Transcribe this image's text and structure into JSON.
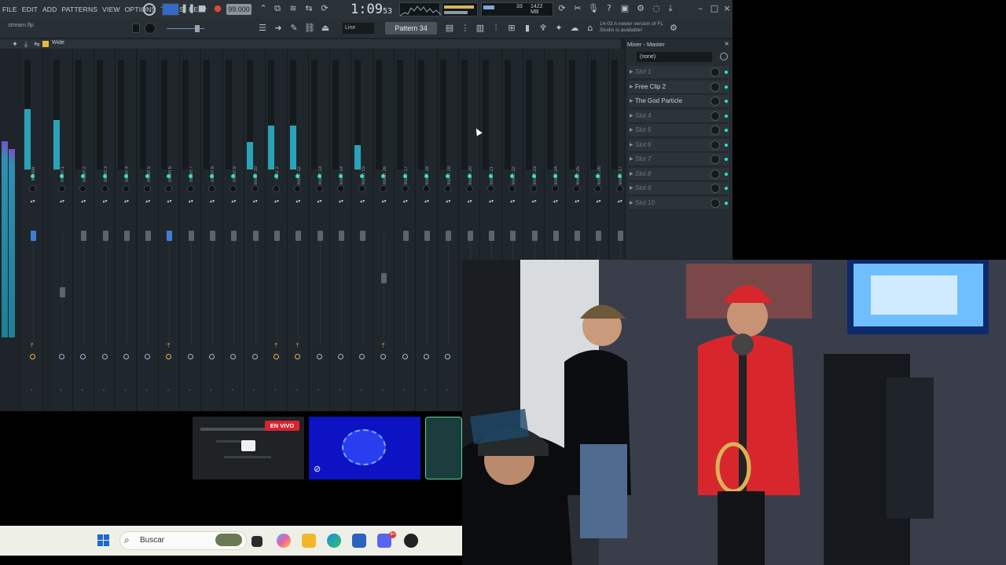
{
  "menu": [
    "FILE",
    "EDIT",
    "ADD",
    "PATTERNS",
    "VIEW",
    "OPTIONS",
    "TOOLS",
    "HELP"
  ],
  "transport": {
    "tempo": "99.000",
    "time_main": "1:09",
    "time_sub": "53",
    "memory": "1422 MB",
    "cpu": "33"
  },
  "project": {
    "name": "stream.flp"
  },
  "toolbar": {
    "snap": "Line",
    "pattern": "Pattern 34",
    "news": "14-03  A newer version of FL Studio is available!"
  },
  "mixer": {
    "view_label": "Wide",
    "panel_title": "Mixer - Master",
    "preset": "(none)",
    "slots": [
      {
        "name": "Slot 1",
        "active": false
      },
      {
        "name": "Free Clip 2",
        "active": true
      },
      {
        "name": "The God Particle",
        "active": true
      },
      {
        "name": "Slot 4",
        "active": false
      },
      {
        "name": "Slot 5",
        "active": false
      },
      {
        "name": "Slot 6",
        "active": false
      },
      {
        "name": "Slot 7",
        "active": false
      },
      {
        "name": "Slot 8",
        "active": false
      },
      {
        "name": "Slot 9",
        "active": false
      },
      {
        "name": "Slot 10",
        "active": false
      }
    ],
    "strips": [
      {
        "label": "Master",
        "level": 0.55
      },
      {
        "label": "Insert 1",
        "level": 0.45
      },
      {
        "label": "Insert 2",
        "level": 0
      },
      {
        "label": "Insert 3",
        "level": 0
      },
      {
        "label": "Insert 4",
        "level": 0
      },
      {
        "label": "Insert 5",
        "level": 0
      },
      {
        "label": "Insert 6",
        "level": 0
      },
      {
        "label": "Insert 7",
        "level": 0
      },
      {
        "label": "Insert 8",
        "level": 0
      },
      {
        "label": "Insert 9",
        "level": 0
      },
      {
        "label": "Insert 10",
        "level": 0.25
      },
      {
        "label": "VOZ 2",
        "level": 0.4
      },
      {
        "label": "Insert 12",
        "level": 0.4
      },
      {
        "label": "Insert 13",
        "level": 0
      },
      {
        "label": "Insert 14",
        "level": 0
      },
      {
        "label": "Insert 15",
        "level": 0.22
      },
      {
        "label": "Insert 16",
        "level": 0
      },
      {
        "label": "Insert 17",
        "level": 0
      },
      {
        "label": "Insert 18",
        "level": 0
      },
      {
        "label": "Insert 19",
        "level": 0
      },
      {
        "label": "Insert 20",
        "level": 0
      },
      {
        "label": "Insert 21",
        "level": 0
      },
      {
        "label": "Insert 22",
        "level": 0
      },
      {
        "label": "Insert 23",
        "level": 0
      },
      {
        "label": "Insert 24",
        "level": 0
      },
      {
        "label": "Insert 25",
        "level": 0
      },
      {
        "label": "Insert 26",
        "level": 0
      },
      {
        "label": "Insert 27",
        "level": 0
      }
    ]
  },
  "stream": {
    "live_badge": "EN VIVO"
  },
  "taskbar": {
    "search_placeholder": "Buscar",
    "discord_badge": "9+"
  }
}
